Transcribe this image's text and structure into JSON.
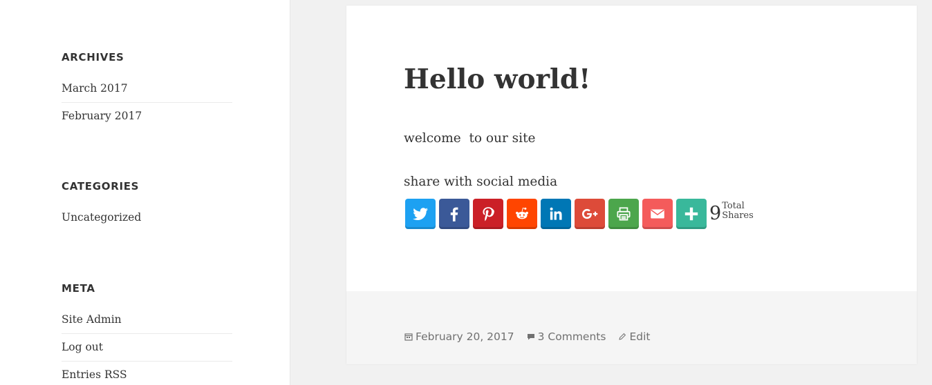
{
  "sidebar": {
    "archives": {
      "title": "ARCHIVES",
      "items": [
        {
          "label": "March 2017"
        },
        {
          "label": "February 2017"
        }
      ]
    },
    "categories": {
      "title": "CATEGORIES",
      "items": [
        {
          "label": "Uncategorized"
        }
      ]
    },
    "meta": {
      "title": "META",
      "items": [
        {
          "label": "Site Admin"
        },
        {
          "label": "Log out"
        },
        {
          "label": "Entries RSS"
        }
      ]
    }
  },
  "post": {
    "title": "Hello world!",
    "paragraphs": [
      "welcome  to our site",
      "share with social media"
    ],
    "share": {
      "buttons": [
        {
          "name": "twitter-icon",
          "color": "#1da1f2"
        },
        {
          "name": "facebook-icon",
          "color": "#3b5998"
        },
        {
          "name": "pinterest-icon",
          "color": "#cb2027"
        },
        {
          "name": "reddit-icon",
          "color": "#ff4500"
        },
        {
          "name": "linkedin-icon",
          "color": "#0077b5"
        },
        {
          "name": "google-plus-icon",
          "color": "#dd4b39"
        },
        {
          "name": "print-icon",
          "color": "#4ca64c"
        },
        {
          "name": "email-icon",
          "color": "#f45b5b"
        },
        {
          "name": "more-icon",
          "color": "#39b89b"
        }
      ],
      "total_count": "9",
      "total_label_line1": "Total",
      "total_label_line2": "Shares"
    },
    "footer": {
      "date": "February 20, 2017",
      "comments": "3 Comments",
      "edit": "Edit"
    }
  }
}
